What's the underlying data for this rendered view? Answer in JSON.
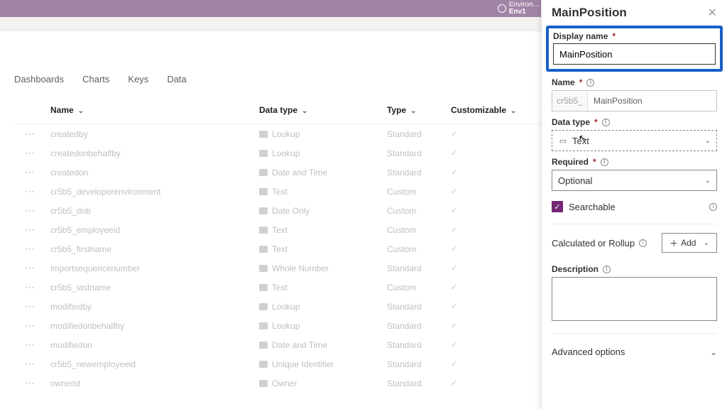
{
  "env": {
    "label": "Environ...",
    "name": "Env1"
  },
  "tabs": [
    "Dashboards",
    "Charts",
    "Keys",
    "Data"
  ],
  "table": {
    "headers": {
      "name": "Name",
      "datatype": "Data type",
      "type": "Type",
      "customizable": "Customizable"
    },
    "rows": [
      {
        "name": "createdby",
        "datatype": "Lookup",
        "type": "Standard",
        "cust": "✓"
      },
      {
        "name": "createdonbehalfby",
        "datatype": "Lookup",
        "type": "Standard",
        "cust": "✓"
      },
      {
        "name": "createdon",
        "datatype": "Date and Time",
        "type": "Standard",
        "cust": "✓"
      },
      {
        "name": "cr5b5_developerenvironment",
        "datatype": "Text",
        "type": "Custom",
        "cust": "✓"
      },
      {
        "name": "cr5b5_dob",
        "datatype": "Date Only",
        "type": "Custom",
        "cust": "✓"
      },
      {
        "name": "cr5b5_employeeid",
        "datatype": "Text",
        "type": "Custom",
        "cust": "✓"
      },
      {
        "name": "cr5b5_firstname",
        "datatype": "Text",
        "type": "Custom",
        "cust": "✓"
      },
      {
        "name": "importsequencenumber",
        "datatype": "Whole Number",
        "type": "Standard",
        "cust": "✓"
      },
      {
        "name": "cr5b5_lastname",
        "datatype": "Text",
        "type": "Custom",
        "cust": "✓"
      },
      {
        "name": "modifiedby",
        "datatype": "Lookup",
        "type": "Standard",
        "cust": "✓"
      },
      {
        "name": "modifiedonbehalfby",
        "datatype": "Lookup",
        "type": "Standard",
        "cust": "✓"
      },
      {
        "name": "modifiedon",
        "datatype": "Date and Time",
        "type": "Standard",
        "cust": "✓"
      },
      {
        "name": "cr5b5_newemployeeid",
        "datatype": "Unique Identifier",
        "type": "Standard",
        "cust": "✓"
      },
      {
        "name": "ownerid",
        "datatype": "Owner",
        "type": "Standard",
        "cust": "✓"
      }
    ]
  },
  "panel": {
    "title": "MainPosition",
    "display_name_label": "Display name",
    "display_name_value": "MainPosition",
    "name_label": "Name",
    "name_prefix": "cr5b5_",
    "name_value": "MainPosition",
    "datatype_label": "Data type",
    "datatype_value": "Text",
    "required_label": "Required",
    "required_value": "Optional",
    "searchable_label": "Searchable",
    "calc_label": "Calculated or Rollup",
    "add_label": "Add",
    "description_label": "Description",
    "advanced_label": "Advanced options"
  }
}
